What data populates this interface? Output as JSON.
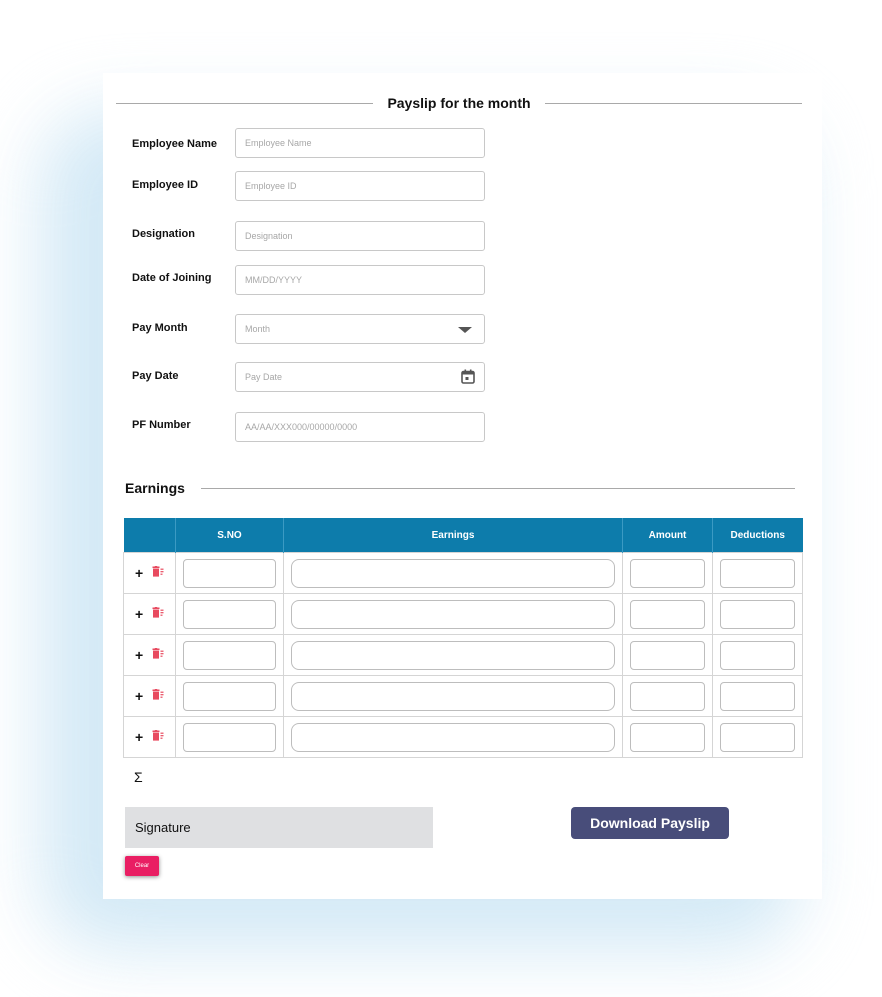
{
  "form": {
    "title": "Payslip for the month",
    "fields": [
      {
        "label": "Employee Name",
        "placeholder": "Employee Name"
      },
      {
        "label": "Employee ID",
        "placeholder": "Employee ID"
      },
      {
        "label": "Designation",
        "placeholder": "Designation"
      },
      {
        "label": "Date of Joining",
        "placeholder": "MM/DD/YYYY"
      },
      {
        "label": "Pay Month",
        "placeholder": "Month"
      },
      {
        "label": "Pay Date",
        "placeholder": "Pay Date"
      },
      {
        "label": "PF Number",
        "placeholder": "AA/AA/XXX000/00000/0000"
      }
    ]
  },
  "earnings": {
    "section_title": "Earnings",
    "columns": [
      "",
      "S.NO",
      "Earnings",
      "Amount",
      "Deductions"
    ],
    "row_count": 5,
    "add_symbol": "+",
    "sum_symbol": "Σ"
  },
  "signature": {
    "label": "Signature",
    "clear_label": "Clear"
  },
  "actions": {
    "download_label": "Download Payslip"
  },
  "icons": {
    "add": "plus-icon",
    "delete": "trash-icon",
    "dropdown": "chevron-down-icon",
    "calendar": "calendar-icon"
  },
  "colors": {
    "table_header": "#0d7cab",
    "download_button": "#484d7a",
    "clear_button": "#e91e63",
    "delete_icon": "#e84a5f"
  }
}
